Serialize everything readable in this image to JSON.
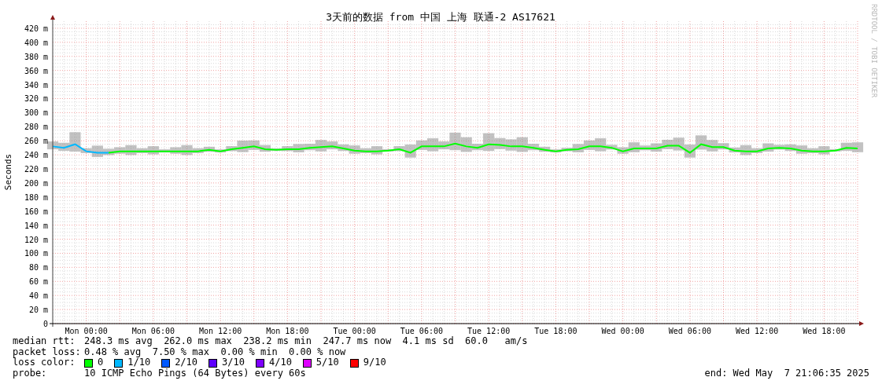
{
  "chart_data": {
    "type": "line",
    "title": "3天前的数据 from 中国 上海 联通-2 AS17621",
    "ylabel": "Seconds",
    "categories": [
      null,
      null,
      null,
      "Mon 00:00",
      null,
      null,
      null,
      null,
      null,
      "Mon 06:00",
      null,
      null,
      null,
      null,
      null,
      "Mon 12:00",
      null,
      null,
      null,
      null,
      null,
      "Mon 18:00",
      null,
      null,
      null,
      null,
      null,
      "Tue 00:00",
      null,
      null,
      null,
      null,
      null,
      "Tue 06:00",
      null,
      null,
      null,
      null,
      null,
      "Tue 12:00",
      null,
      null,
      null,
      null,
      null,
      "Tue 18:00",
      null,
      null,
      null,
      null,
      null,
      "Wed 00:00",
      null,
      null,
      null,
      null,
      null,
      "Wed 06:00",
      null,
      null,
      null,
      null,
      null,
      "Wed 12:00",
      null,
      null,
      null,
      null,
      null,
      "Wed 18:00",
      null,
      null,
      null
    ],
    "series": [
      {
        "color": "#00ff00",
        "values": [
          null,
          null,
          null,
          null,
          null,
          243,
          245,
          245,
          245,
          245,
          245,
          245,
          245,
          245,
          247,
          245,
          248,
          250,
          252,
          248,
          247,
          248,
          248,
          250,
          251,
          252,
          249,
          246,
          245,
          245,
          246,
          248,
          243,
          252,
          252,
          252,
          256,
          252,
          250,
          255,
          254,
          252,
          252,
          250,
          247,
          245,
          247,
          248,
          252,
          252,
          250,
          245,
          249,
          249,
          249,
          253,
          253,
          243,
          255,
          251,
          251,
          246,
          245,
          245,
          249,
          250,
          249,
          246,
          245,
          245,
          246,
          250,
          249
        ]
      },
      {
        "color": "#00b8ff",
        "values": [
          252,
          250,
          255,
          245,
          243,
          243,
          null,
          null,
          null,
          null,
          null,
          null,
          null,
          null,
          null,
          null,
          null,
          null,
          null,
          null,
          null,
          null,
          null,
          null,
          null,
          null,
          null,
          null,
          null,
          null,
          null,
          null,
          null,
          null,
          null,
          null,
          null,
          null,
          null,
          null,
          null,
          null,
          null,
          null,
          null,
          null,
          null,
          null,
          null,
          null,
          null,
          null,
          null,
          null,
          null,
          null,
          null,
          null,
          null,
          null,
          null,
          null,
          null,
          null,
          null,
          null,
          null,
          null,
          null,
          null,
          null,
          null,
          null
        ]
      }
    ],
    "ylim": [
      0,
      430
    ],
    "grid": true,
    "yticks": [
      {
        "value": 0,
        "label": "0"
      },
      {
        "value": 20,
        "label": "20 m"
      },
      {
        "value": 40,
        "label": "40 m"
      },
      {
        "value": 60,
        "label": "60 m"
      },
      {
        "value": 80,
        "label": "80 m"
      },
      {
        "value": 100,
        "label": "100 m"
      },
      {
        "value": 120,
        "label": "120 m"
      },
      {
        "value": 140,
        "label": "140 m"
      },
      {
        "value": 160,
        "label": "160 m"
      },
      {
        "value": 180,
        "label": "180 m"
      },
      {
        "value": 200,
        "label": "200 m"
      },
      {
        "value": 220,
        "label": "220 m"
      },
      {
        "value": 240,
        "label": "240 m"
      },
      {
        "value": 260,
        "label": "260 m"
      },
      {
        "value": 280,
        "label": "280 m"
      },
      {
        "value": 300,
        "label": "300 m"
      },
      {
        "value": 320,
        "label": "320 m"
      },
      {
        "value": 340,
        "label": "340 m"
      },
      {
        "value": 360,
        "label": "360 m"
      },
      {
        "value": 380,
        "label": "380 m"
      },
      {
        "value": 400,
        "label": "400 m"
      },
      {
        "value": 420,
        "label": "420 m"
      }
    ]
  },
  "credit": "RRDTOOL / TOBI OETIKER",
  "stats": [
    {
      "label": "median rtt:",
      "text": "248.3 ms avg  262.0 ms max  238.2 ms min  247.7 ms now  4.1 ms sd  60.0   am/s"
    },
    {
      "label": "packet loss:",
      "text": "0.48 % avg  7.50 % max  0.00 % min  0.00 % now"
    }
  ],
  "loss_color": {
    "label": "loss color:",
    "items": [
      {
        "label": "0",
        "color": "#00ff00"
      },
      {
        "label": "1/10",
        "color": "#00b8ff"
      },
      {
        "label": "2/10",
        "color": "#0059ff"
      },
      {
        "label": "3/10",
        "color": "#5e00ff"
      },
      {
        "label": "4/10",
        "color": "#7e00ff"
      },
      {
        "label": "5/10",
        "color": "#dd00ff"
      },
      {
        "label": "9/10",
        "color": "#ff0000"
      }
    ]
  },
  "probe": {
    "label": "probe:",
    "text": "10 ICMP Echo Pings (64 Bytes) every 60s"
  },
  "end": "end: Wed May  7 21:06:35 2025"
}
